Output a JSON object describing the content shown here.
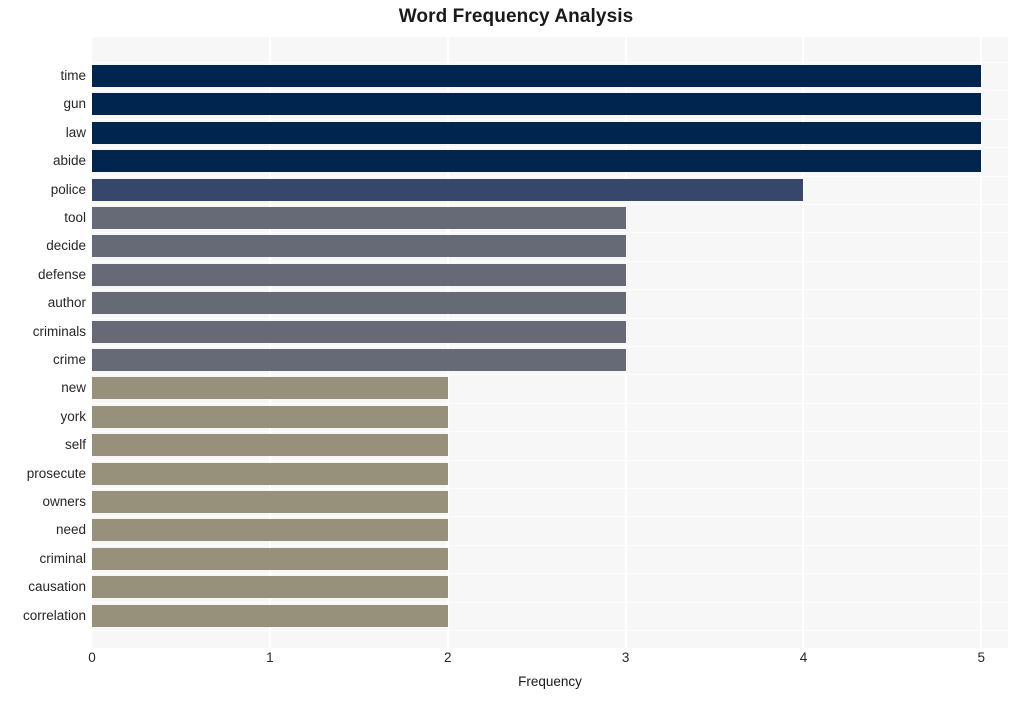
{
  "chart_data": {
    "type": "bar",
    "orientation": "horizontal",
    "title": "Word Frequency Analysis",
    "xlabel": "Frequency",
    "ylabel": "",
    "xlim": [
      0,
      5.15
    ],
    "xticks": [
      0,
      1,
      2,
      3,
      4,
      5
    ],
    "xtick_labels": [
      "0",
      "1",
      "2",
      "3",
      "4",
      "5"
    ],
    "grid": true,
    "legend": false,
    "categories": [
      "time",
      "gun",
      "law",
      "abide",
      "police",
      "tool",
      "decide",
      "defense",
      "author",
      "criminals",
      "crime",
      "new",
      "york",
      "self",
      "prosecute",
      "owners",
      "need",
      "criminal",
      "causation",
      "correlation"
    ],
    "values": [
      5,
      5,
      5,
      5,
      4,
      3,
      3,
      3,
      3,
      3,
      3,
      2,
      2,
      2,
      2,
      2,
      2,
      2,
      2,
      2
    ],
    "bar_colors": [
      "#00254f",
      "#00254f",
      "#00254f",
      "#00254f",
      "#37466b",
      "#666a76",
      "#666a76",
      "#666a76",
      "#666a76",
      "#666a76",
      "#666a76",
      "#97917c",
      "#97917c",
      "#97917c",
      "#97917c",
      "#97917c",
      "#97917c",
      "#97917c",
      "#97917c",
      "#97917c"
    ]
  },
  "style": {
    "plot_background": "#f7f7f7",
    "figure_background": "#ffffff",
    "grid_color": "#ffffff",
    "title_color": "#1a1a1a",
    "tick_color": "#262626"
  }
}
